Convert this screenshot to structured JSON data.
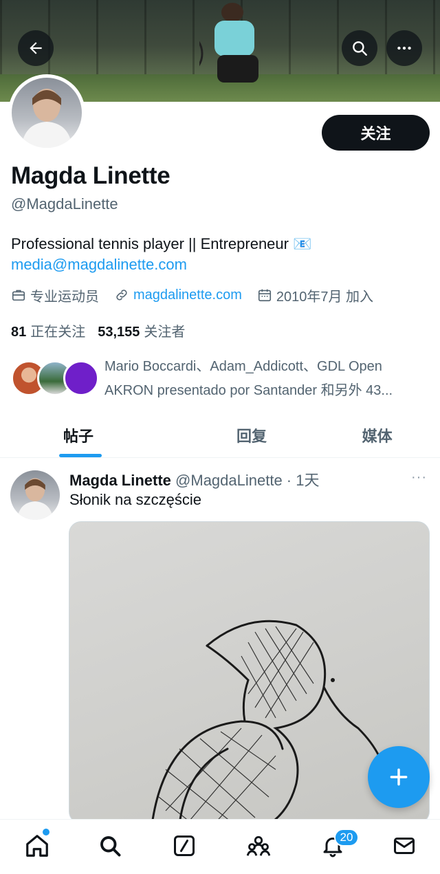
{
  "header": {
    "back_icon": "arrow-left-icon",
    "search_icon": "search-icon",
    "more_icon": "more-horizontal-icon"
  },
  "profile": {
    "follow_label": "关注",
    "display_name": "Magda Linette",
    "handle": "@MagdaLinette",
    "bio": "Professional tennis player || Entrepreneur 📧",
    "bio_email": "media@magdalinette.com",
    "profession": "专业运动员",
    "website": "magdalinette.com",
    "joined": "2010年7月 加入",
    "following_count": "81",
    "following_label": "正在关注",
    "followers_count": "53,155",
    "followers_label": "关注者",
    "followed_by_line1": "Mario Boccardi、Adam_Addicott、GDL Open",
    "followed_by_line2": "AKRON presentado por Santander 和另外 43..."
  },
  "tabs": [
    {
      "label": "帖子",
      "active": true
    },
    {
      "label": "回复",
      "active": false
    },
    {
      "label": "媒体",
      "active": false
    }
  ],
  "post": {
    "name": "Magda Linette",
    "handle": "@MagdaLinette",
    "time": " · 1天",
    "text": "Słonik na szczęście",
    "more": "···"
  },
  "bottom_nav": {
    "notifications_badge": "20",
    "items": [
      "home-icon",
      "search-icon",
      "grok-icon",
      "communities-icon",
      "bell-icon",
      "mail-icon"
    ]
  },
  "colors": {
    "accent": "#1d9bf0",
    "text": "#0f1419",
    "secondary": "#536471"
  }
}
